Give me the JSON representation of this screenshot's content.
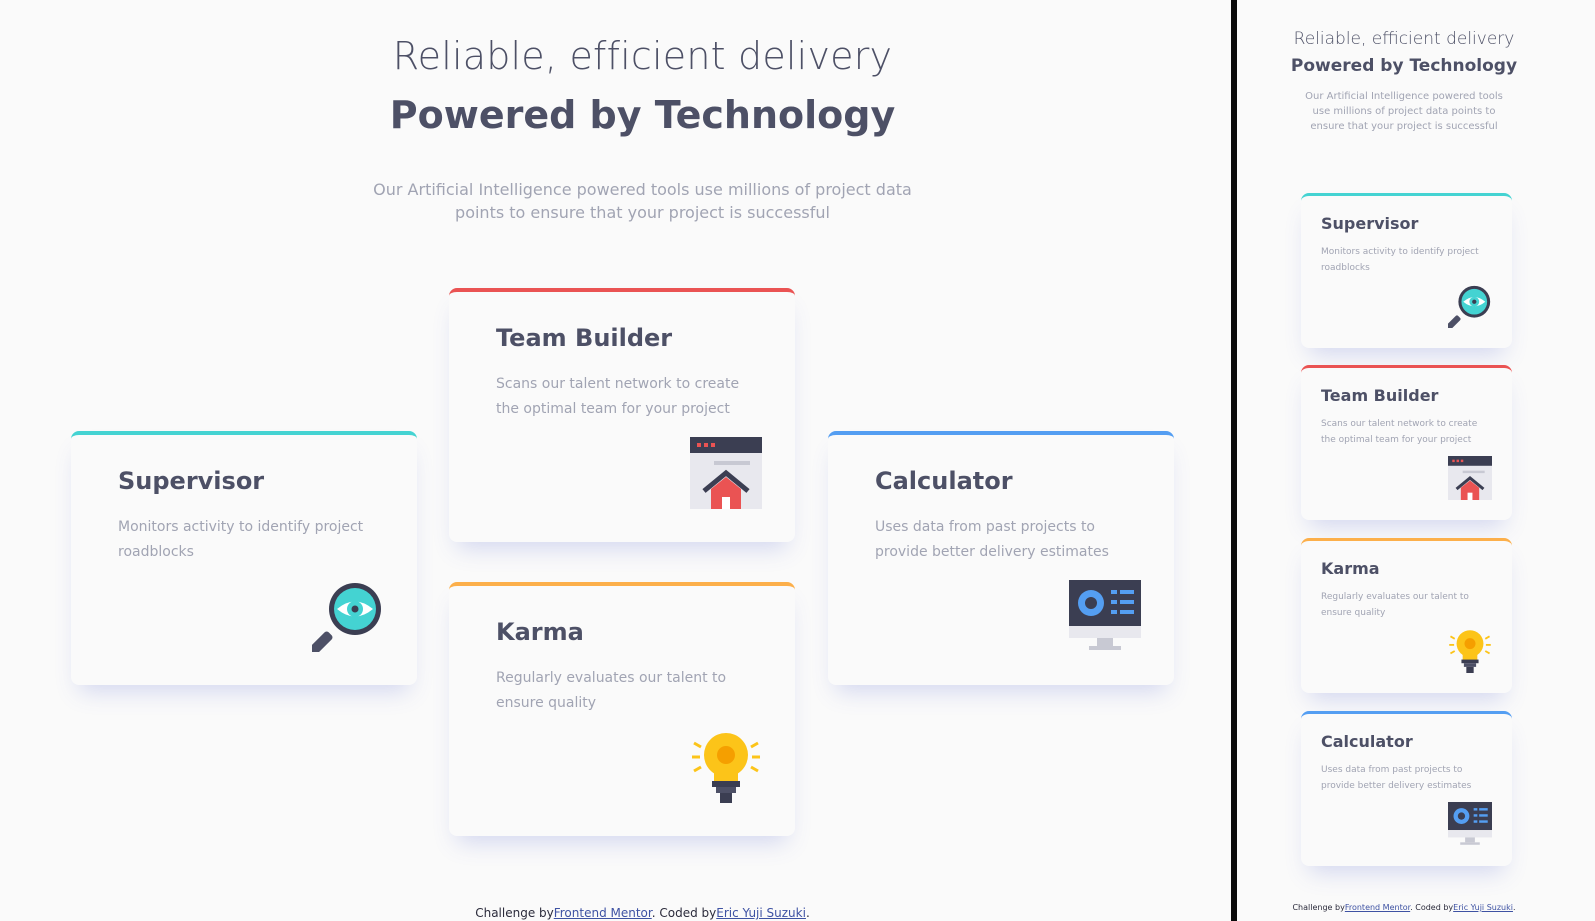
{
  "header": {
    "title_light": "Reliable, efficient delivery",
    "title_bold": "Powered by Technology",
    "subtitle": "Our Artificial Intelligence powered tools use millions of project data points to ensure that your project is successful"
  },
  "cards": {
    "supervisor": {
      "title": "Supervisor",
      "description": "Monitors activity to identify project roadblocks",
      "icon": "magnifier-eye-icon",
      "accent": "#44d3d2"
    },
    "team_builder": {
      "title": "Team Builder",
      "description": "Scans our talent network to create the optimal team for your project",
      "icon": "browser-house-icon",
      "accent": "#ea5353"
    },
    "karma": {
      "title": "Karma",
      "description": "Regularly evaluates our talent to ensure quality",
      "icon": "lightbulb-icon",
      "accent": "#fcaf4a"
    },
    "calculator": {
      "title": "Calculator",
      "description": "Uses data from past projects to provide better delivery estimates",
      "icon": "monitor-chart-icon",
      "accent": "#549ef2"
    }
  },
  "footer": {
    "prefix": "Challenge by",
    "link1": "Frontend Mentor",
    "middle": ". Coded by",
    "link2": "Eric Yuji Suzuki",
    "suffix": "."
  },
  "colors": {
    "background": "#fafafa",
    "heading": "#4d5066",
    "muted": "#a1a4b3",
    "cyan": "#44d3d2",
    "red": "#ea5353",
    "orange": "#fcaf4a",
    "blue": "#549ef2"
  }
}
